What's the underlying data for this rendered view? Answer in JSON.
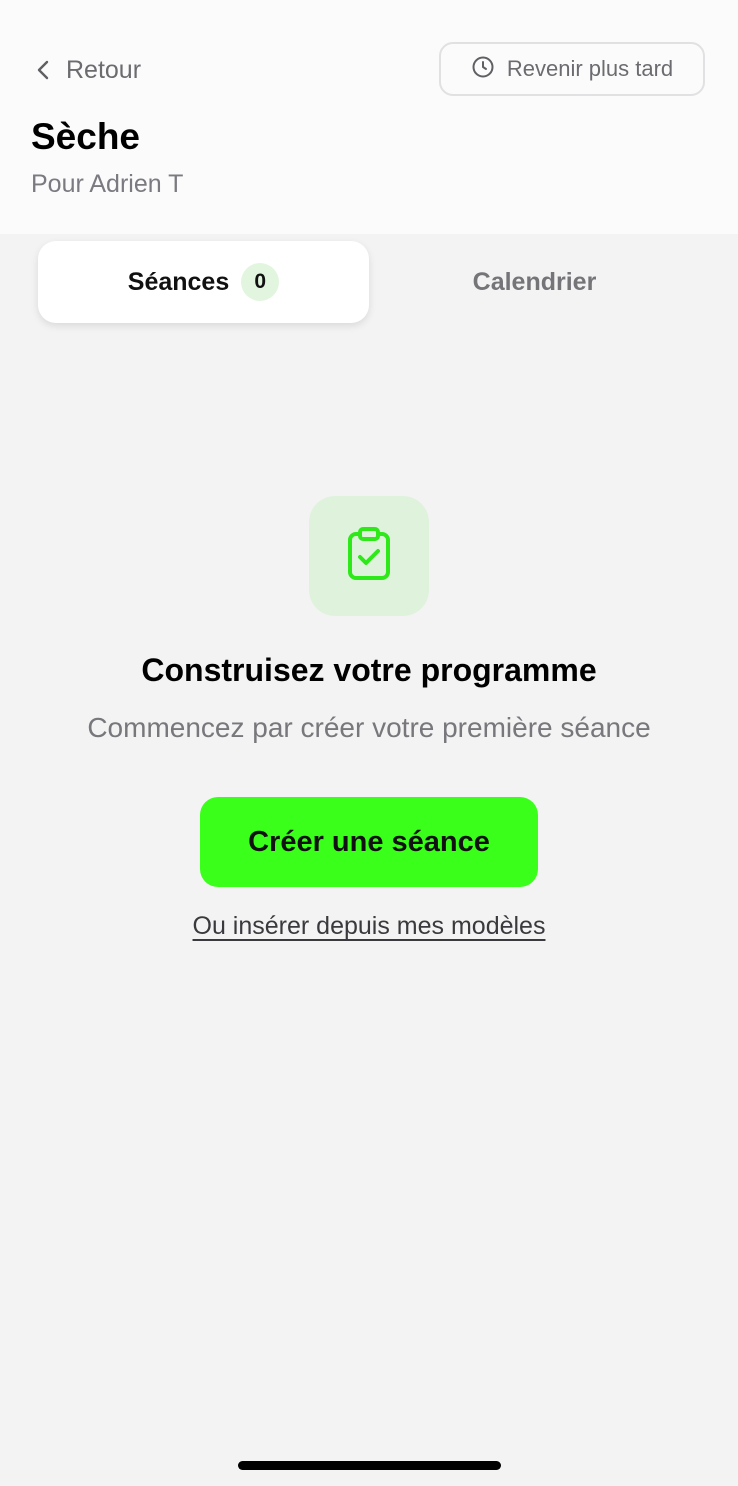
{
  "header": {
    "back_label": "Retour",
    "back_icon": "chevron-left-icon",
    "later_label": "Revenir plus tard",
    "later_icon": "clock-icon",
    "title": "Sèche",
    "subtitle": "Pour Adrien T"
  },
  "tabs": [
    {
      "label": "Séances",
      "count": "0",
      "active": true
    },
    {
      "label": "Calendrier",
      "active": false
    }
  ],
  "empty_state": {
    "icon": "clipboard-check-icon",
    "title": "Construisez votre programme",
    "subtitle": "Commencez par créer votre première séance",
    "primary_button": "Créer une séance",
    "secondary_link": "Ou insérer depuis mes modèles"
  },
  "colors": {
    "accent": "#39ff1a",
    "accent_soft": "#dff3dc",
    "background": "#f3f3f3"
  }
}
